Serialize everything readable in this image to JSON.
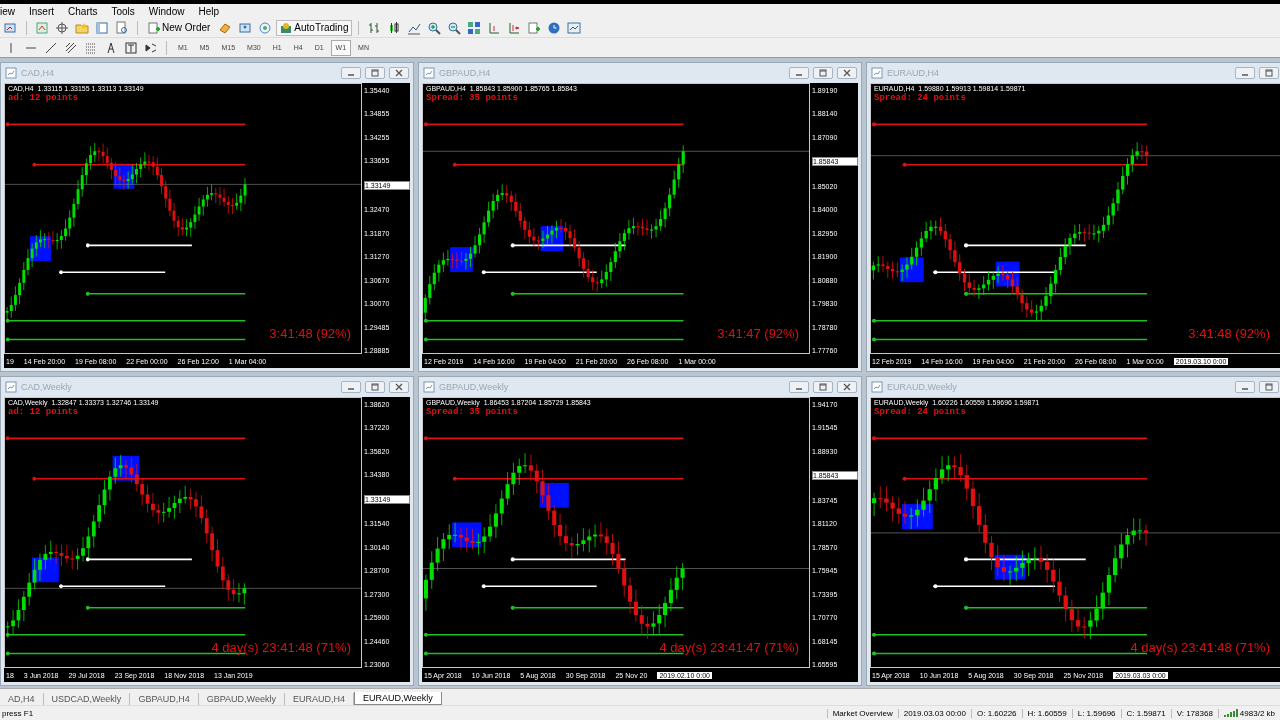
{
  "menu": [
    "iew",
    "Insert",
    "Charts",
    "Tools",
    "Window",
    "Help"
  ],
  "toolbar": {
    "buttons": [
      {
        "label": "New Order"
      },
      {
        "label": "AutoTrading"
      }
    ]
  },
  "timeframes": [
    {
      "label": "M1",
      "selected": false
    },
    {
      "label": "M5",
      "selected": false
    },
    {
      "label": "M15",
      "selected": false
    },
    {
      "label": "M30",
      "selected": false
    },
    {
      "label": "H1",
      "selected": false
    },
    {
      "label": "H4",
      "selected": false
    },
    {
      "label": "D1",
      "selected": false
    },
    {
      "label": "W1",
      "selected": true
    },
    {
      "label": "MN",
      "selected": false
    }
  ],
  "charts": [
    {
      "title": "CAD,H4",
      "header": "CAD,H4  1.33115 1.33155 1.33113 1.33149",
      "spread": "ad: 12 points",
      "timer": "3:41:48 (92%)",
      "price_labels": [
        {
          "text": "1.35440",
          "kind": "tick"
        },
        {
          "text": "1.34855",
          "kind": "tick"
        },
        {
          "text": "1.34255",
          "kind": "tick"
        },
        {
          "text": "1.33655",
          "kind": "tick"
        },
        {
          "text": "1.33149",
          "kind": "current"
        },
        {
          "text": "1.32470",
          "kind": "tick"
        },
        {
          "text": "1.31870",
          "kind": "tick"
        },
        {
          "text": "1.31270",
          "kind": "tick"
        },
        {
          "text": "1.30670",
          "kind": "tick"
        },
        {
          "text": "1.30070",
          "kind": "tick"
        },
        {
          "text": "1.29485",
          "kind": "tick"
        },
        {
          "text": "1.28885",
          "kind": "tick"
        }
      ],
      "time_labels": [
        {
          "text": "19",
          "kind": "tick"
        },
        {
          "text": "14 Feb 20:00",
          "kind": "tick"
        },
        {
          "text": "19 Feb 08:00",
          "kind": "tick"
        },
        {
          "text": "22 Feb 00:00",
          "kind": "tick"
        },
        {
          "text": "26 Feb 12:00",
          "kind": "tick"
        },
        {
          "text": "1 Mar 04:00",
          "kind": "tick"
        }
      ]
    },
    {
      "title": "GBPAUD,H4",
      "header": "GBPAUD,H4  1.85843 1.85900 1.85765 1.85843",
      "spread": "Spread: 35 points",
      "timer": "3:41:47 (92%)",
      "price_labels": [
        {
          "text": "1.89190",
          "kind": "tick"
        },
        {
          "text": "1.88140",
          "kind": "tick"
        },
        {
          "text": "1.87090",
          "kind": "tick"
        },
        {
          "text": "1.85843",
          "kind": "current"
        },
        {
          "text": "1.85020",
          "kind": "tick"
        },
        {
          "text": "1.84000",
          "kind": "tick"
        },
        {
          "text": "1.82950",
          "kind": "tick"
        },
        {
          "text": "1.81900",
          "kind": "tick"
        },
        {
          "text": "1.80880",
          "kind": "tick"
        },
        {
          "text": "1.79830",
          "kind": "tick"
        },
        {
          "text": "1.78780",
          "kind": "tick"
        },
        {
          "text": "1.77760",
          "kind": "tick"
        }
      ],
      "time_labels": [
        {
          "text": "12 Feb 2019",
          "kind": "tick"
        },
        {
          "text": "14 Feb 16:00",
          "kind": "tick"
        },
        {
          "text": "19 Feb 04:00",
          "kind": "tick"
        },
        {
          "text": "21 Feb 20:00",
          "kind": "tick"
        },
        {
          "text": "26 Feb 08:00",
          "kind": "tick"
        },
        {
          "text": "1 Mar 00:00",
          "kind": "tick"
        }
      ]
    },
    {
      "title": "EURAUD,H4",
      "header": "EURAUD,H4  1.59880 1.59913 1.59814 1.59871",
      "spread": "Spread: 24 points",
      "timer": "3:41:48 (92%)",
      "time_labels": [
        {
          "text": "12 Feb 2019",
          "kind": "tick"
        },
        {
          "text": "14 Feb 16:00",
          "kind": "tick"
        },
        {
          "text": "19 Feb 04:00",
          "kind": "tick"
        },
        {
          "text": "21 Feb 20:00",
          "kind": "tick"
        },
        {
          "text": "26 Feb 08:00",
          "kind": "tick"
        },
        {
          "text": "1 Mar 00:00",
          "kind": "tick"
        },
        {
          "text": "2019.03.10 0:00",
          "kind": "crosshair"
        }
      ]
    },
    {
      "title": "CAD,Weekly",
      "header": "CAD,Weekly  1.32847 1.33373 1.32746 1.33149",
      "spread": "ad: 12 points",
      "timer": "4 day(s) 23:41:48 (71%)",
      "price_labels": [
        {
          "text": "1.38620",
          "kind": "tick"
        },
        {
          "text": "1.37220",
          "kind": "tick"
        },
        {
          "text": "1.35820",
          "kind": "tick"
        },
        {
          "text": "1.34380",
          "kind": "tick"
        },
        {
          "text": "1.33149",
          "kind": "current"
        },
        {
          "text": "1.31540",
          "kind": "tick"
        },
        {
          "text": "1.30140",
          "kind": "tick"
        },
        {
          "text": "1.28700",
          "kind": "tick"
        },
        {
          "text": "1.27300",
          "kind": "tick"
        },
        {
          "text": "1.25900",
          "kind": "tick"
        },
        {
          "text": "1.24460",
          "kind": "tick"
        },
        {
          "text": "1.23060",
          "kind": "tick"
        }
      ],
      "time_labels": [
        {
          "text": "18",
          "kind": "tick"
        },
        {
          "text": "3 Jun 2018",
          "kind": "tick"
        },
        {
          "text": "29 Jul 2018",
          "kind": "tick"
        },
        {
          "text": "23 Sep 2018",
          "kind": "tick"
        },
        {
          "text": "18 Nov 2018",
          "kind": "tick"
        },
        {
          "text": "13 Jan 2019",
          "kind": "tick"
        }
      ]
    },
    {
      "title": "GBPAUD,Weekly",
      "header": "GBPAUD,Weekly  1.86453 1.87204 1.85729 1.85843",
      "spread": "Spread: 35 points",
      "timer": "4 day(s) 23:41:47 (71%)",
      "price_labels": [
        {
          "text": "1.94170",
          "kind": "tick"
        },
        {
          "text": "1.91545",
          "kind": "tick"
        },
        {
          "text": "1.88930",
          "kind": "tick"
        },
        {
          "text": "1.85843",
          "kind": "current"
        },
        {
          "text": "1.83745",
          "kind": "tick"
        },
        {
          "text": "1.81120",
          "kind": "tick"
        },
        {
          "text": "1.78570",
          "kind": "tick"
        },
        {
          "text": "1.75945",
          "kind": "tick"
        },
        {
          "text": "1.73395",
          "kind": "tick"
        },
        {
          "text": "1.70770",
          "kind": "tick"
        },
        {
          "text": "1.68145",
          "kind": "tick"
        },
        {
          "text": "1.65595",
          "kind": "tick"
        }
      ],
      "time_labels": [
        {
          "text": "15 Apr 2018",
          "kind": "tick"
        },
        {
          "text": "10 Jun 2018",
          "kind": "tick"
        },
        {
          "text": "5 Aug 2018",
          "kind": "tick"
        },
        {
          "text": "30 Sep 2018",
          "kind": "tick"
        },
        {
          "text": "25 Nov 20",
          "kind": "tick"
        },
        {
          "text": "2019.02.10 0:00",
          "kind": "crosshair"
        }
      ]
    },
    {
      "title": "EURAUD,Weekly",
      "header": "EURAUD,Weekly  1.60226 1.60559 1.59696 1.59871",
      "spread": "Spread: 24 points",
      "timer": "4 day(s) 23:41:48 (71%)",
      "time_labels": [
        {
          "text": "15 Apr 2018",
          "kind": "tick"
        },
        {
          "text": "10 Jun 2018",
          "kind": "tick"
        },
        {
          "text": "5 Aug 2018",
          "kind": "tick"
        },
        {
          "text": "30 Sep 2018",
          "kind": "tick"
        },
        {
          "text": "25 Nov 2018",
          "kind": "tick"
        },
        {
          "text": "2019.03.03 0:00",
          "kind": "crosshair"
        }
      ]
    }
  ],
  "tabs": [
    {
      "label": "AD,H4",
      "selected": false
    },
    {
      "label": "USDCAD,Weekly",
      "selected": false
    },
    {
      "label": "GBPAUD,H4",
      "selected": false
    },
    {
      "label": "GBPAUD,Weekly",
      "selected": false
    },
    {
      "label": "EURAUD,H4",
      "selected": false
    },
    {
      "label": "EURAUD,Weekly",
      "selected": true
    }
  ],
  "status_bar": {
    "help": "press F1",
    "profile": "Market Overview",
    "time": "2019.03.03 00:00",
    "open": "O: 1.60226",
    "high": "H: 1.60559",
    "low": "L: 1.59696",
    "close": "C: 1.59871",
    "volume": "V: 178368",
    "traffic": "4983/2 kb"
  }
}
